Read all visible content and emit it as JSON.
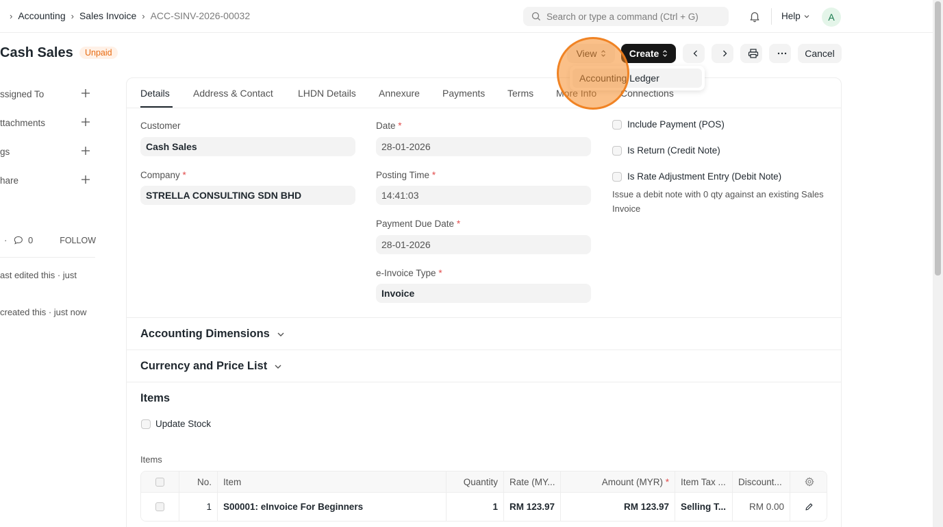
{
  "breadcrumb": {
    "items": [
      "Accounting",
      "Sales Invoice",
      "ACC-SINV-2026-00032"
    ]
  },
  "search": {
    "placeholder": "Search or type a command (Ctrl + G)"
  },
  "navbar": {
    "help_label": "Help",
    "avatar_initial": "A"
  },
  "page": {
    "title": "Cash Sales",
    "status": "Unpaid",
    "view_label": "View",
    "create_label": "Create",
    "cancel_label": "Cancel",
    "dropdown_item": "Accounting Ledger"
  },
  "sidebar": {
    "items": [
      {
        "label": "ssigned To"
      },
      {
        "label": "ttachments"
      },
      {
        "label": "gs"
      },
      {
        "label": "hare"
      }
    ],
    "comment_count": "0",
    "follow_label": "FOLLOW",
    "activity": [
      "ast edited this · just",
      "created this · just now"
    ]
  },
  "tabs": [
    "Details",
    "Address & Contact",
    "LHDN Details",
    "Annexure",
    "Payments",
    "Terms",
    "More Info",
    "Connections"
  ],
  "form": {
    "customer_label": "Customer",
    "customer_value": "Cash Sales",
    "company_label": "Company",
    "company_value": "STRELLA CONSULTING SDN BHD",
    "date_label": "Date",
    "date_value": "28-01-2026",
    "posting_time_label": "Posting Time",
    "posting_time_value": "14:41:03",
    "due_date_label": "Payment Due Date",
    "due_date_value": "28-01-2026",
    "einvoice_type_label": "e-Invoice Type",
    "einvoice_type_value": "Invoice",
    "include_payment_label": "Include Payment (POS)",
    "is_return_label": "Is Return (Credit Note)",
    "rate_adjust_label": "Is Rate Adjustment Entry (Debit Note)",
    "rate_adjust_desc": "Issue a debit note with 0 qty against an existing Sales Invoice"
  },
  "sections": {
    "accounting_dimensions": "Accounting Dimensions",
    "currency_price_list": "Currency and Price List",
    "items": "Items",
    "update_stock_label": "Update Stock",
    "items_table_label": "Items"
  },
  "items_table": {
    "columns": [
      "No.",
      "Item",
      "Quantity",
      "Rate (MY...",
      "Amount (MYR)",
      "Item Tax ...",
      "Discount..."
    ],
    "rows": [
      {
        "no": "1",
        "item": "S00001: eInvoice For Beginners",
        "qty": "1",
        "rate": "RM 123.97",
        "amount": "RM 123.97",
        "tax": "Selling T...",
        "discount": "RM 0.00"
      }
    ]
  },
  "colors": {
    "accent": "#171717",
    "status_unpaid_bg": "#fff1e7",
    "status_unpaid_fg": "#e86c13",
    "required": "#e24c4c",
    "click_highlight": "#f58c28"
  }
}
